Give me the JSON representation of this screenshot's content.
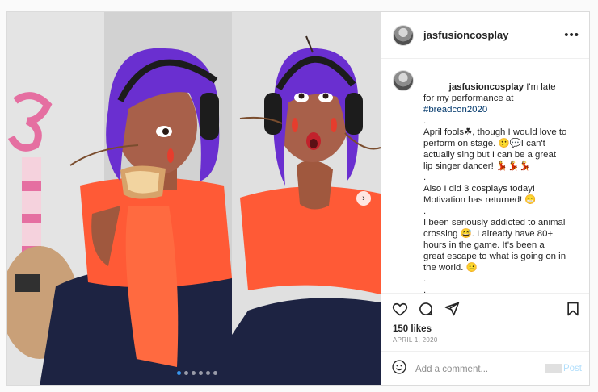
{
  "post": {
    "username": "jasfusioncosplay",
    "caption_paragraphs": [
      {
        "author": "jasfusioncosplay",
        "text_before": " I'm late for my performance at ",
        "hashtag": "#breadcon2020"
      },
      {
        "text": "."
      },
      {
        "text": "April fools☘, though I would love to perform on stage. 😕💬I can't actually sing but I can be a great lip singer dancer! 💃💃💃"
      },
      {
        "text": "."
      },
      {
        "text": "Also I did 3 cosplays today! Motivation has returned! 😁"
      },
      {
        "text": "."
      },
      {
        "text": "I been seriously addicted to animal crossing 😅. I already have 80+ hours in the game. It's been a great escape to what is going on in the world. 😐"
      },
      {
        "text": "."
      },
      {
        "text": "."
      },
      {
        "text": "."
      }
    ],
    "likes": "150 likes",
    "date": "APRIL 1, 2020",
    "comment_placeholder": "Add a comment...",
    "post_label": "Post",
    "carousel": {
      "count": 6,
      "active": 0
    }
  }
}
